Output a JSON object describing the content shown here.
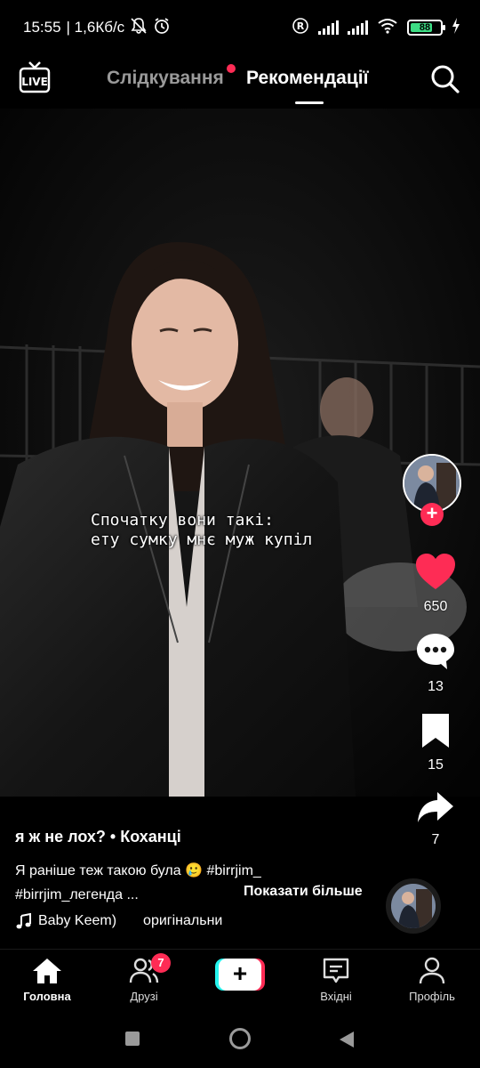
{
  "status_bar": {
    "time": "15:55",
    "net_speed": "| 1,6Кб/с",
    "battery": "88",
    "icons": [
      "mute-icon",
      "alarm-icon",
      "registered-icon",
      "signal-icon",
      "signal-icon",
      "wifi-icon",
      "battery-icon",
      "charging-icon"
    ]
  },
  "top_nav": {
    "live_label": "LIVE",
    "tabs": [
      {
        "label": "Слідкування",
        "active": false
      },
      {
        "label": "Рекомендації",
        "active": true
      }
    ],
    "notification_dot_color": "#fe2c55"
  },
  "video": {
    "overlay_text": "Спочатку вони такі:\nету сумку мнє муж купіл"
  },
  "actions": {
    "likes": "650",
    "comments": "13",
    "saves": "15",
    "shares": "7",
    "like_color": "#fe2c55"
  },
  "post": {
    "author": "я ж не лох? • Коханці",
    "description_line1": "Я раніше теж такою була 🥲 #birrjim_",
    "description_line2": "#birrjim_легенда ...",
    "show_more": "Показати більше",
    "music_artist": "Baby Keem)",
    "music_original": "оригінальни"
  },
  "tab_bar": {
    "home": "Головна",
    "friends": "Друзі",
    "friends_badge": "7",
    "inbox": "Вхідні",
    "profile": "Профіль",
    "create": "+"
  },
  "colors": {
    "accent_red": "#fe2c55",
    "accent_cyan": "#25f4ee",
    "battery_green": "#3ddc84"
  }
}
